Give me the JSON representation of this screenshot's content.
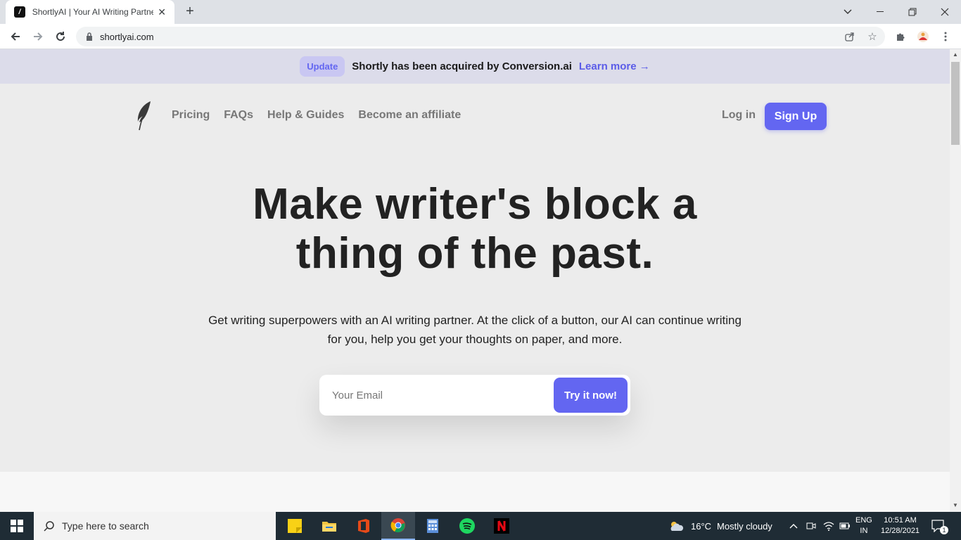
{
  "browser": {
    "tab_title": "ShortlyAI | Your AI Writing Partner",
    "tab_close": "✕",
    "new_tab": "+",
    "url": "shortlyai.com"
  },
  "banner": {
    "badge": "Update",
    "message": "Shortly has been acquired by Conversion.ai",
    "link": "Learn more →"
  },
  "nav": {
    "links": [
      "Pricing",
      "FAQs",
      "Help & Guides",
      "Become an affiliate"
    ],
    "login": "Log in",
    "signup": "Sign Up"
  },
  "hero": {
    "headline_line1": "Make writer's block a",
    "headline_line2": "thing of the past.",
    "subtext": "Get writing superpowers with an AI writing partner. At the click of a button, our AI can continue writing for you, help you get your thoughts on paper, and more."
  },
  "form": {
    "email_placeholder": "Your Email",
    "cta": "Try it now!"
  },
  "taskbar": {
    "search_placeholder": "Type here to search",
    "weather_temp": "16°C",
    "weather_text": "Mostly cloudy",
    "lang_top": "ENG",
    "lang_bottom": "IN",
    "time": "10:51 AM",
    "date": "12/28/2021",
    "notification_count": "1"
  },
  "colors": {
    "accent": "#6366f1",
    "banner_bg": "#dcdcea",
    "page_bg": "#ececec"
  }
}
